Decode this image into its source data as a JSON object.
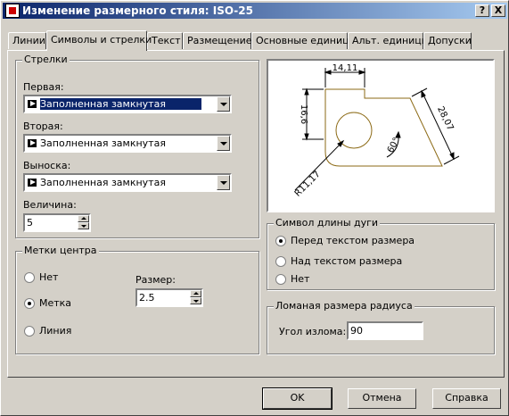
{
  "window": {
    "title": "Изменение размерного стиля: ISO-25",
    "help_button": "?",
    "close_button": "X"
  },
  "tabs": [
    {
      "label": "Линии"
    },
    {
      "label": "Символы и стрелки"
    },
    {
      "label": "Текст"
    },
    {
      "label": "Размещение"
    },
    {
      "label": "Основные единицы"
    },
    {
      "label": "Альт. единицы"
    },
    {
      "label": "Допуски"
    }
  ],
  "arrows": {
    "title": "Стрелки",
    "first_label": "Первая:",
    "first_value": "Заполненная замкнутая",
    "second_label": "Вторая:",
    "second_value": "Заполненная замкнутая",
    "leader_label": "Выноска:",
    "leader_value": "Заполненная замкнутая",
    "size_label": "Величина:",
    "size_value": "5"
  },
  "center_marks": {
    "title": "Метки центра",
    "options": [
      {
        "label": "Нет",
        "selected": false
      },
      {
        "label": "Метка",
        "selected": true
      },
      {
        "label": "Линия",
        "selected": false
      }
    ],
    "size_label": "Размер:",
    "size_value": "2.5"
  },
  "preview": {
    "dim_top": "14,11",
    "dim_left": "16,6",
    "dim_right": "28,07",
    "dim_angle": "60°",
    "dim_radius": "R11,17",
    "line_color": "#8b6914"
  },
  "arc_length": {
    "title": "Символ длины дуги",
    "options": [
      {
        "label": "Перед текстом размера",
        "selected": true
      },
      {
        "label": "Над текстом размера",
        "selected": false
      },
      {
        "label": "Нет",
        "selected": false
      }
    ]
  },
  "jog": {
    "title": "Ломаная размера радиуса",
    "angle_label": "Угол излома:",
    "angle_value": "90"
  },
  "buttons": {
    "ok": "OK",
    "cancel": "Отмена",
    "help": "Справка"
  }
}
